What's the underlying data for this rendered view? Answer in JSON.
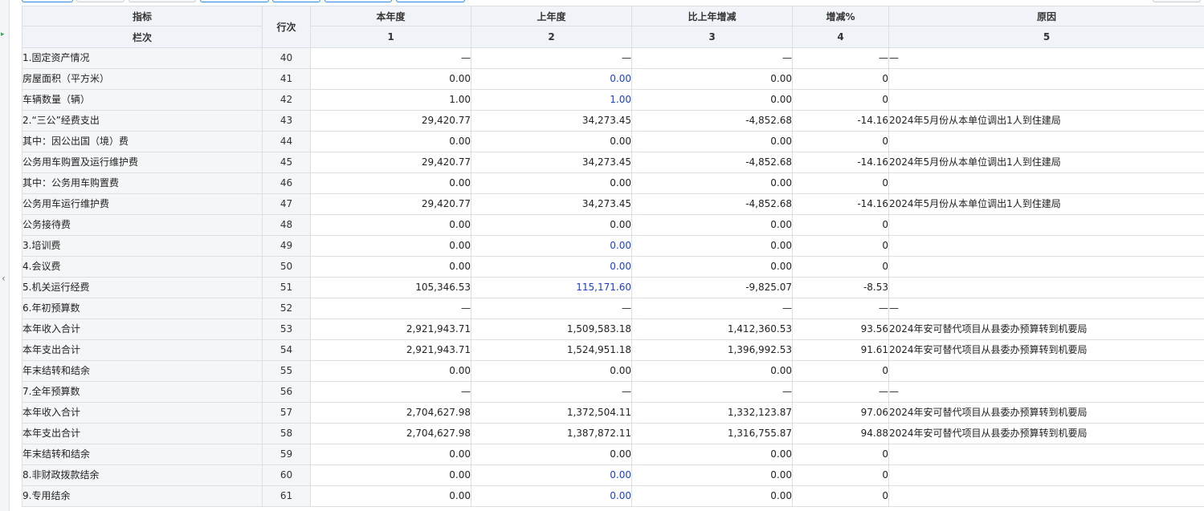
{
  "header": {
    "indicator": "指标",
    "column_label": "栏次",
    "line_no": "行次",
    "col_this_year": "本年度",
    "col_last_year": "上年度",
    "col_change": "比上年增减",
    "col_change_pct": "增减%",
    "col_reason": "原因",
    "n1": "1",
    "n2": "2",
    "n3": "3",
    "n4": "4",
    "n5": "5"
  },
  "rows": [
    {
      "label": "1.固定资产情况",
      "line": "40",
      "c1": "—",
      "c2": "—",
      "c3": "—",
      "c4": "—",
      "reason": "—",
      "indent": 0,
      "blue": false
    },
    {
      "label": "房屋面积（平方米）",
      "line": "41",
      "c1": "0.00",
      "c2": "0.00",
      "c3": "0.00",
      "c4": "0",
      "reason": "",
      "indent": 1,
      "blue": true
    },
    {
      "label": "车辆数量（辆）",
      "line": "42",
      "c1": "1.00",
      "c2": "1.00",
      "c3": "0.00",
      "c4": "0",
      "reason": "",
      "indent": 1,
      "blue": true
    },
    {
      "label": "2.“三公”经费支出",
      "line": "43",
      "c1": "29,420.77",
      "c2": "34,273.45",
      "c3": "-4,852.68",
      "c4": "-14.16",
      "reason": "2024年5月份从本单位调出1人到住建局",
      "indent": 0,
      "blue": false
    },
    {
      "label": "其中：因公出国（境）费",
      "line": "44",
      "c1": "0.00",
      "c2": "0.00",
      "c3": "0.00",
      "c4": "0",
      "reason": "",
      "indent": 1,
      "blue": false
    },
    {
      "label": "公务用车购置及运行维护费",
      "line": "45",
      "c1": "29,420.77",
      "c2": "34,273.45",
      "c3": "-4,852.68",
      "c4": "-14.16",
      "reason": "2024年5月份从本单位调出1人到住建局",
      "indent": 2,
      "blue": false
    },
    {
      "label": "其中：公务用车购置费",
      "line": "46",
      "c1": "0.00",
      "c2": "0.00",
      "c3": "0.00",
      "c4": "0",
      "reason": "",
      "indent": 2,
      "blue": false
    },
    {
      "label": "公务用车运行维护费",
      "line": "47",
      "c1": "29,420.77",
      "c2": "34,273.45",
      "c3": "-4,852.68",
      "c4": "-14.16",
      "reason": "2024年5月份从本单位调出1人到住建局",
      "indent": 3,
      "blue": false
    },
    {
      "label": "公务接待费",
      "line": "48",
      "c1": "0.00",
      "c2": "0.00",
      "c3": "0.00",
      "c4": "0",
      "reason": "",
      "indent": 2,
      "blue": false
    },
    {
      "label": "3.培训费",
      "line": "49",
      "c1": "0.00",
      "c2": "0.00",
      "c3": "0.00",
      "c4": "0",
      "reason": "",
      "indent": 0,
      "blue": true
    },
    {
      "label": "4.会议费",
      "line": "50",
      "c1": "0.00",
      "c2": "0.00",
      "c3": "0.00",
      "c4": "0",
      "reason": "",
      "indent": 0,
      "blue": true
    },
    {
      "label": "5.机关运行经费",
      "line": "51",
      "c1": "105,346.53",
      "c2": "115,171.60",
      "c3": "-9,825.07",
      "c4": "-8.53",
      "reason": "",
      "indent": 0,
      "blue": true
    },
    {
      "label": "6.年初预算数",
      "line": "52",
      "c1": "—",
      "c2": "—",
      "c3": "—",
      "c4": "—",
      "reason": "—",
      "indent": 0,
      "blue": false
    },
    {
      "label": "本年收入合计",
      "line": "53",
      "c1": "2,921,943.71",
      "c2": "1,509,583.18",
      "c3": "1,412,360.53",
      "c4": "93.56",
      "reason": "2024年安可替代项目从县委办预算转到机要局",
      "indent": 1,
      "blue": false
    },
    {
      "label": "本年支出合计",
      "line": "54",
      "c1": "2,921,943.71",
      "c2": "1,524,951.18",
      "c3": "1,396,992.53",
      "c4": "91.61",
      "reason": "2024年安可替代项目从县委办预算转到机要局",
      "indent": 1,
      "blue": false
    },
    {
      "label": "年末结转和结余",
      "line": "55",
      "c1": "0.00",
      "c2": "0.00",
      "c3": "0.00",
      "c4": "0",
      "reason": "",
      "indent": 1,
      "blue": false
    },
    {
      "label": "7.全年预算数",
      "line": "56",
      "c1": "—",
      "c2": "—",
      "c3": "—",
      "c4": "—",
      "reason": "—",
      "indent": 0,
      "blue": false
    },
    {
      "label": "本年收入合计",
      "line": "57",
      "c1": "2,704,627.98",
      "c2": "1,372,504.11",
      "c3": "1,332,123.87",
      "c4": "97.06",
      "reason": "2024年安可替代项目从县委办预算转到机要局",
      "indent": 1,
      "blue": false
    },
    {
      "label": "本年支出合计",
      "line": "58",
      "c1": "2,704,627.98",
      "c2": "1,387,872.11",
      "c3": "1,316,755.87",
      "c4": "94.88",
      "reason": "2024年安可替代项目从县委办预算转到机要局",
      "indent": 1,
      "blue": false
    },
    {
      "label": "年末结转和结余",
      "line": "59",
      "c1": "0.00",
      "c2": "0.00",
      "c3": "0.00",
      "c4": "0",
      "reason": "",
      "indent": 1,
      "blue": false
    },
    {
      "label": "8.非财政拨款结余",
      "line": "60",
      "c1": "0.00",
      "c2": "0.00",
      "c3": "0.00",
      "c4": "0",
      "reason": "",
      "indent": 0,
      "blue": true
    },
    {
      "label": "9.专用结余",
      "line": "61",
      "c1": "0.00",
      "c2": "0.00",
      "c3": "0.00",
      "c4": "0",
      "reason": "",
      "indent": 0,
      "blue": true
    }
  ],
  "colors": {
    "header_bg": "#f0f3f8",
    "label_bg": "#f5f6f8",
    "border": "#dcdfe6",
    "linked_value": "#1a3fc9",
    "toolbar_accent": "#2f8de4"
  }
}
